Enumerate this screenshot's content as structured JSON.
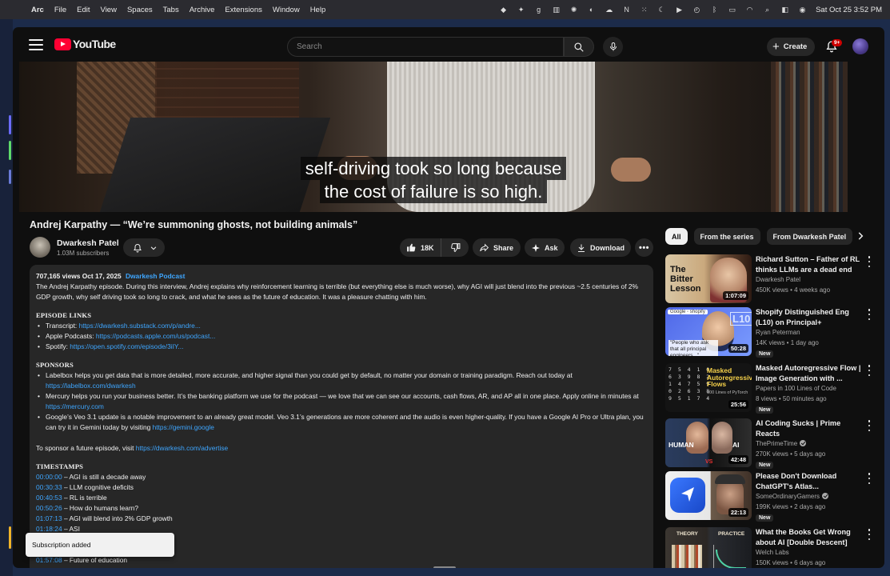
{
  "menubar": {
    "app_name": "Arc",
    "menus": [
      "File",
      "Edit",
      "View",
      "Spaces",
      "Tabs",
      "Archive",
      "Extensions",
      "Window",
      "Help"
    ],
    "clock": "Sat Oct 25  3:52 PM"
  },
  "header": {
    "logo_text": "YouTube",
    "search_placeholder": "Search",
    "create_label": "Create",
    "notification_badge": "9+"
  },
  "player": {
    "caption_line1": "self-driving took so long because",
    "caption_line2": "the cost of failure is so high."
  },
  "video": {
    "title": "Andrej Karpathy — “We’re summoning ghosts, not building animals”",
    "channel_name": "Dwarkesh Patel",
    "subscribers": "1.03M subscribers",
    "like_count": "18K",
    "share_label": "Share",
    "ask_label": "Ask",
    "download_label": "Download"
  },
  "description": {
    "views_date": "707,165 views  Oct 17, 2025",
    "hashtag": "Dwarkesh Podcast",
    "intro": "The Andrej Karpathy episode. During this interview, Andrej explains why reinforcement learning is terrible (but everything else is much worse), why AGI will just blend into the previous ~2.5 centuries of 2% GDP growth, why self driving took so long to crack, and what he sees as the future of education. It was a pleasure chatting with him.",
    "episode_links_heading": "EPISODE LINKS",
    "episode_links": [
      {
        "label": "Transcript:",
        "url": "https://dwarkesh.substack.com/p/andre..."
      },
      {
        "label": "Apple Podcasts:",
        "url": "https://podcasts.apple.com/us/podcast..."
      },
      {
        "label": "Spotify:",
        "url": "https://open.spotify.com/episode/3iIY..."
      }
    ],
    "sponsors_heading": "SPONSORS",
    "sponsors": [
      {
        "text": "Labelbox helps you get data that is more detailed, more accurate, and higher signal than you could get by default, no matter your domain or training paradigm. Reach out today at ",
        "url": "https://labelbox.com/dwarkesh"
      },
      {
        "text": "Mercury helps you run your business better. It’s the banking platform we use for the podcast — we love that we can see our accounts, cash flows, AR, and AP all in one place. Apply online in minutes at ",
        "url": "https://mercury.com"
      },
      {
        "text": "Google’s Veo 3.1 update is a notable improvement to an already great model. Veo 3.1’s generations are more coherent and the audio is even higher-quality. If you have a Google AI Pro or Ultra plan, you can try it in Gemini today by visiting ",
        "url": "https://gemini.google"
      }
    ],
    "advertise_text": "To sponsor a future episode, visit ",
    "advertise_url": "https://dwarkesh.com/advertise",
    "timestamps_heading": "TIMESTAMPS",
    "timestamps": [
      {
        "time": "00:00:00",
        "label": "– AGI is still a decade away"
      },
      {
        "time": "00:30:33",
        "label": "– LLM cognitive deficits"
      },
      {
        "time": "00:40:53",
        "label": "– RL is terrible"
      },
      {
        "time": "00:50:26",
        "label": "– How do humans learn?"
      },
      {
        "time": "01:07:13",
        "label": "– AGI will blend into 2% GDP growth"
      },
      {
        "time": "01:18:24",
        "label": "– ASI"
      },
      {
        "time": "",
        "label": "re"
      },
      {
        "time": "",
        "label": ""
      },
      {
        "time": "01:57:08",
        "label": "– Future of education"
      }
    ]
  },
  "toast": {
    "text": "Subscription added"
  },
  "chips": [
    "All",
    "From the series",
    "From Dwarkesh Patel"
  ],
  "recommendations": [
    {
      "title": "Richard Sutton – Father of RL thinks LLMs are a dead end",
      "channel": "Dwarkesh Patel",
      "verified": false,
      "stats": "450K views • 4 weeks ago",
      "duration": "1:07:09",
      "badge": "",
      "thumb_text": "The Bitter Lesson"
    },
    {
      "title": "Shopify Distinguished Eng (L10) on Principal+ Engineering, ...",
      "channel": "Ryan Peterman",
      "verified": false,
      "stats": "14K views • 1 day ago",
      "duration": "50:28",
      "badge": "New",
      "thumb_text": "\"People who ask that all principal engineers...\"",
      "thumb_tag": "Google ◦ shopify",
      "thumb_level": "L10"
    },
    {
      "title": "Masked Autoregressive Flow | Image Generation with ...",
      "channel": "Papers in 100 Lines of Code",
      "verified": false,
      "stats": "8 views • 50 minutes ago",
      "duration": "25:56",
      "badge": "New",
      "thumb_text": "Masked Autoregressive Flows",
      "thumb_sub": "100 Lines of PyTorch"
    },
    {
      "title": "AI Coding Sucks | Prime Reacts",
      "channel": "ThePrimeTime",
      "verified": true,
      "stats": "270K views • 5 days ago",
      "duration": "42:48",
      "badge": "New",
      "thumb_left": "HUMAN",
      "thumb_right": "AI",
      "thumb_mid": "VS"
    },
    {
      "title": "Please Don't Download ChatGPT's Atlas...",
      "channel": "SomeOrdinaryGamers",
      "verified": true,
      "stats": "199K views • 2 days ago",
      "duration": "22:13",
      "badge": "New"
    },
    {
      "title": "What the Books Get Wrong about AI [Double Descent]",
      "channel": "Welch Labs",
      "verified": false,
      "stats": "150K views • 6 days ago",
      "duration": "",
      "badge": "",
      "thumb_left": "THEORY",
      "thumb_right": "PRACTICE"
    }
  ]
}
